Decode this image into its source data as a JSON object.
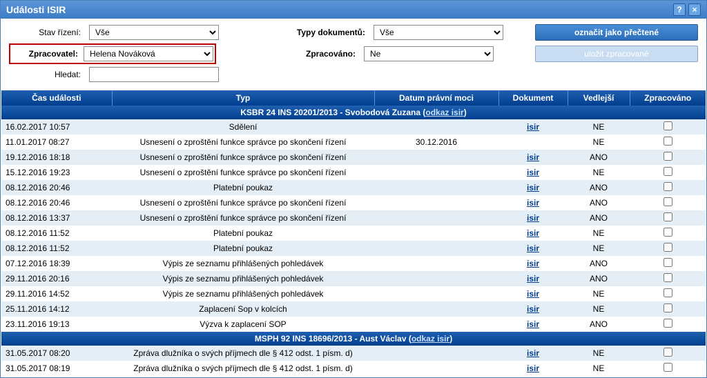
{
  "window": {
    "title": "Události ISIR"
  },
  "filters": {
    "stav_label": "Stav řízení:",
    "stav_value": "Vše",
    "typy_label": "Typy dokumentů:",
    "typy_value": "Vše",
    "zprac_label": "Zpracovatel:",
    "zprac_value": "Helena Nováková",
    "zprno_label": "Zpracováno:",
    "zprno_value": "Ne",
    "hledat_label": "Hledat:",
    "hledat_value": ""
  },
  "buttons": {
    "mark_read": "označit jako přečtené",
    "save_processed": "uložit zpracované"
  },
  "columns": {
    "time": "Čas události",
    "type": "Typ",
    "date": "Datum právní moci",
    "doc": "Dokument",
    "ved": "Vedlejší",
    "zprac": "Zpracováno"
  },
  "groups": [
    {
      "case": "KSBR 24 INS 20201/2013 - Svobodová Zuzana",
      "link_text": "odkaz isir",
      "rows": [
        {
          "time": "16.02.2017 10:57",
          "type": "Sdělení",
          "date": "",
          "doc": "isir",
          "ved": "NE"
        },
        {
          "time": "11.01.2017 08:27",
          "type": "Usnesení o zproštění funkce správce po skončení řízení",
          "date": "30.12.2016",
          "doc": "",
          "ved": "NE"
        },
        {
          "time": "19.12.2016 18:18",
          "type": "Usnesení o zproštění funkce správce po skončení řízení",
          "date": "",
          "doc": "isir",
          "ved": "ANO"
        },
        {
          "time": "15.12.2016 19:23",
          "type": "Usnesení o zproštění funkce správce po skončení řízení",
          "date": "",
          "doc": "isir",
          "ved": "NE"
        },
        {
          "time": "08.12.2016 20:46",
          "type": "Platební poukaz",
          "date": "",
          "doc": "isir",
          "ved": "ANO"
        },
        {
          "time": "08.12.2016 20:46",
          "type": "Usnesení o zproštění funkce správce po skončení řízení",
          "date": "",
          "doc": "isir",
          "ved": "ANO"
        },
        {
          "time": "08.12.2016 13:37",
          "type": "Usnesení o zproštění funkce správce po skončení řízení",
          "date": "",
          "doc": "isir",
          "ved": "ANO"
        },
        {
          "time": "08.12.2016 11:52",
          "type": "Platební poukaz",
          "date": "",
          "doc": "isir",
          "ved": "NE"
        },
        {
          "time": "08.12.2016 11:52",
          "type": "Platební poukaz",
          "date": "",
          "doc": "isir",
          "ved": "NE"
        },
        {
          "time": "07.12.2016 18:39",
          "type": "Výpis ze seznamu přihlášených pohledávek",
          "date": "",
          "doc": "isir",
          "ved": "ANO"
        },
        {
          "time": "29.11.2016 20:16",
          "type": "Výpis ze seznamu přihlášených pohledávek",
          "date": "",
          "doc": "isir",
          "ved": "ANO"
        },
        {
          "time": "29.11.2016 14:52",
          "type": "Výpis ze seznamu přihlášených pohledávek",
          "date": "",
          "doc": "isir",
          "ved": "NE"
        },
        {
          "time": "25.11.2016 14:12",
          "type": "Zaplacení Sop v kolcích",
          "date": "",
          "doc": "isir",
          "ved": "NE"
        },
        {
          "time": "23.11.2016 19:13",
          "type": "Výzva k zaplacení SOP",
          "date": "",
          "doc": "isir",
          "ved": "ANO"
        }
      ]
    },
    {
      "case": "MSPH 92 INS 18696/2013 - Aust Václav",
      "link_text": "odkaz isir",
      "rows": [
        {
          "time": "31.05.2017 08:20",
          "type": "Zpráva dlužníka o svých příjmech dle § 412 odst. 1 písm. d)",
          "date": "",
          "doc": "isir",
          "ved": "NE"
        },
        {
          "time": "31.05.2017 08:19",
          "type": "Zpráva dlužníka o svých příjmech dle § 412 odst. 1 písm. d)",
          "date": "",
          "doc": "isir",
          "ved": "NE"
        }
      ]
    }
  ]
}
